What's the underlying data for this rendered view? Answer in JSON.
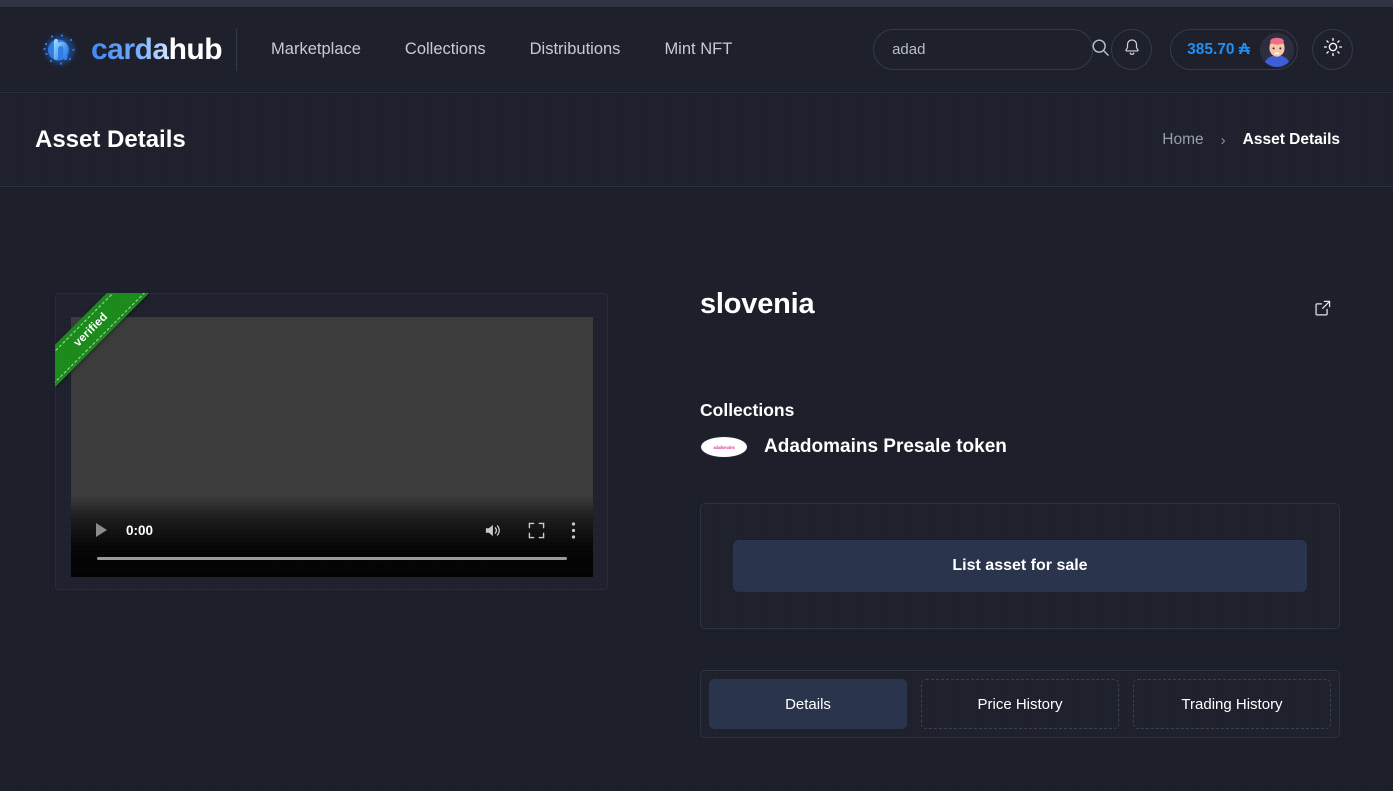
{
  "brand": {
    "name_part1": "carda",
    "name_part2": "hub",
    "logo_icon": "cardahub-logo-icon",
    "accent_blue": "#3f86f5",
    "text_white": "#ffffff"
  },
  "nav": {
    "items": [
      {
        "label": "Marketplace"
      },
      {
        "label": "Collections"
      },
      {
        "label": "Distributions"
      },
      {
        "label": "Mint NFT"
      }
    ]
  },
  "search": {
    "value": "adad",
    "placeholder": "Search",
    "icon": "search-icon"
  },
  "header_actions": {
    "notification_icon": "bell-icon",
    "balance": "385.70 ₳",
    "balance_color": "#1f8ef1",
    "avatar_icon": "user-avatar",
    "theme_toggle_icon": "sun-icon"
  },
  "page": {
    "title": "Asset Details"
  },
  "breadcrumb": {
    "home": "Home",
    "separator": "›",
    "current": "Asset Details"
  },
  "media": {
    "ribbon_label": "verified",
    "ribbon_color": "#188a18",
    "video": {
      "current_time": "0:00",
      "play_icon": "play-icon",
      "volume_icon": "volume-icon",
      "fullscreen_icon": "fullscreen-icon",
      "more_options_icon": "more-vertical-icon",
      "progress_percent": 0
    }
  },
  "asset": {
    "title": "slovenia",
    "external_link_icon": "external-link-icon",
    "collections_heading": "Collections",
    "collection": {
      "name": "Adadomains Presale token",
      "avatar_text": "adadomains",
      "avatar_text_color": "#e0459a"
    },
    "sale_button_label": "List asset for sale",
    "sale_button_color": "#27324b"
  },
  "tabs": {
    "items": [
      {
        "label": "Details",
        "active": true
      },
      {
        "label": "Price History",
        "active": false
      },
      {
        "label": "Trading History",
        "active": false
      }
    ]
  }
}
